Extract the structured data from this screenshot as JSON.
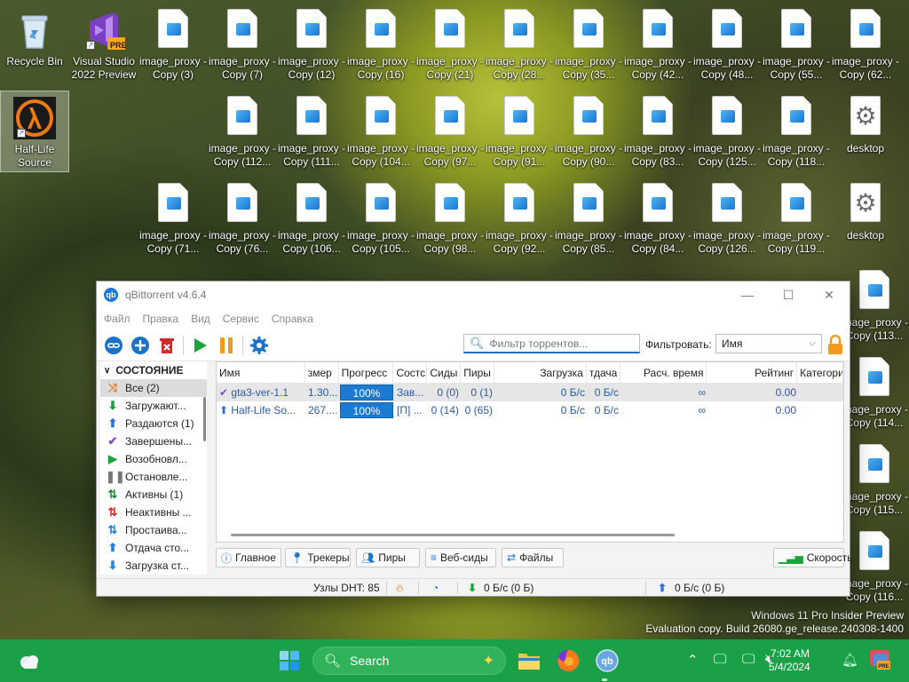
{
  "desktop": {
    "special_icons": [
      {
        "name": "recycle-bin",
        "label": "Recycle Bin"
      },
      {
        "name": "visual-studio",
        "label": "Visual Studio 2022 Preview",
        "badge": "PRE"
      },
      {
        "name": "half-life",
        "label": "Half-Life Source"
      }
    ],
    "row1": [
      "image_proxy - Copy (3)",
      "image_proxy - Copy (7)",
      "image_proxy - Copy (12)",
      "image_proxy - Copy (16)",
      "image_proxy - Copy (21)",
      "image_proxy - Copy (28...",
      "image_proxy - Copy (35...",
      "image_proxy - Copy (42...",
      "image_proxy - Copy (48...",
      "image_proxy - Copy (55...",
      "image_proxy - Copy (62..."
    ],
    "row2": [
      "image_proxy - Copy (112...",
      "image_proxy - Copy (111...",
      "image_proxy - Copy (104...",
      "image_proxy - Copy (97...",
      "image_proxy - Copy (91...",
      "image_proxy - Copy (90...",
      "image_proxy - Copy (83...",
      "image_proxy - Copy (125...",
      "image_proxy - Copy (118...",
      "desktop"
    ],
    "row3": [
      "image_proxy - Copy (71...",
      "image_proxy - Copy (76...",
      "image_proxy - Copy (106...",
      "image_proxy - Copy (105...",
      "image_proxy - Copy (98...",
      "image_proxy - Copy (92...",
      "image_proxy - Copy (85...",
      "image_proxy - Copy (84...",
      "image_proxy - Copy (126...",
      "image_proxy - Copy (119...",
      "desktop"
    ],
    "right_column": [
      "image_proxy - Copy (113...",
      "image_proxy - Copy (114...",
      "image_proxy - Copy (115...",
      "image_proxy - Copy (116..."
    ],
    "watermark": {
      "line1": "Windows 11 Pro Insider Preview",
      "line2": "Evaluation copy. Build 26080.ge_release.240308-1400"
    }
  },
  "qbt": {
    "title": "qBittorrent v4.6.4",
    "menu": [
      "Файл",
      "Правка",
      "Вид",
      "Сервис",
      "Справка"
    ],
    "filter_placeholder": "Фильтр торрентов...",
    "filter_label": "Фильтровать:",
    "filter_value": "Имя",
    "sidebar": {
      "header": "СОСТОЯНИЕ",
      "items": [
        {
          "label": "Все (2)",
          "icon": "shuffle-icon",
          "color": "#e07b2a"
        },
        {
          "label": "Загружают...",
          "icon": "download-icon",
          "color": "#1e9e35"
        },
        {
          "label": "Раздаются (1)",
          "icon": "upload-icon",
          "color": "#2b6fd6"
        },
        {
          "label": "Завершены...",
          "icon": "check-icon",
          "color": "#7b4bd1"
        },
        {
          "label": "Возобновл...",
          "icon": "play-icon",
          "color": "#1ea33a"
        },
        {
          "label": "Остановле...",
          "icon": "pause-icon",
          "color": "#777777"
        },
        {
          "label": "Активны (1)",
          "icon": "active-icon",
          "color": "#1e8a3a"
        },
        {
          "label": "Неактивны ...",
          "icon": "inactive-icon",
          "color": "#d62a2a"
        },
        {
          "label": "Простаива...",
          "icon": "stalled-icon",
          "color": "#2b7fd6"
        },
        {
          "label": "Отдача сто...",
          "icon": "stalled-upload-icon",
          "color": "#2b7fd6"
        },
        {
          "label": "Загрузка ст...",
          "icon": "stalled-download-icon",
          "color": "#2b7fd6"
        }
      ]
    },
    "columns": [
      "Имя",
      "змер",
      "Прогресс",
      "Состс",
      "Сиды",
      "Пиры",
      "Загрузка",
      "тдача",
      "Расч. время",
      "Рейтинг",
      "Категори"
    ],
    "rows": [
      {
        "icon": "check-icon",
        "name": "gta3-ver-1.1",
        "size": "1.30...",
        "progress": "100%",
        "progress_value": 1.0,
        "status": "Зав...",
        "seeds": "0 (0)",
        "peers": "0 (1)",
        "down": "0 Б/с",
        "up": "0 Б/с",
        "eta": "∞",
        "ratio": "0.00"
      },
      {
        "icon": "upload-icon",
        "name": "Half-Life So...",
        "size": "267....",
        "progress": "100%",
        "progress_value": 1.0,
        "status": "[П] ...",
        "seeds": "0 (14)",
        "peers": "0 (65)",
        "down": "0 Б/с",
        "up": "0 Б/с",
        "eta": "∞",
        "ratio": "0.00"
      }
    ],
    "tabs": [
      "Главное",
      "Трекеры",
      "Пиры",
      "Веб-сиды",
      "Файлы"
    ],
    "speed_button": "Скорость",
    "status": {
      "dht": "Узлы DHT: 85",
      "down": "0 Б/с (0 Б)",
      "up": "0 Б/с (0 Б)"
    }
  },
  "taskbar": {
    "search_label": "Search",
    "time": "7:02 AM",
    "date": "5/4/2024",
    "accent": "#1aa047"
  }
}
